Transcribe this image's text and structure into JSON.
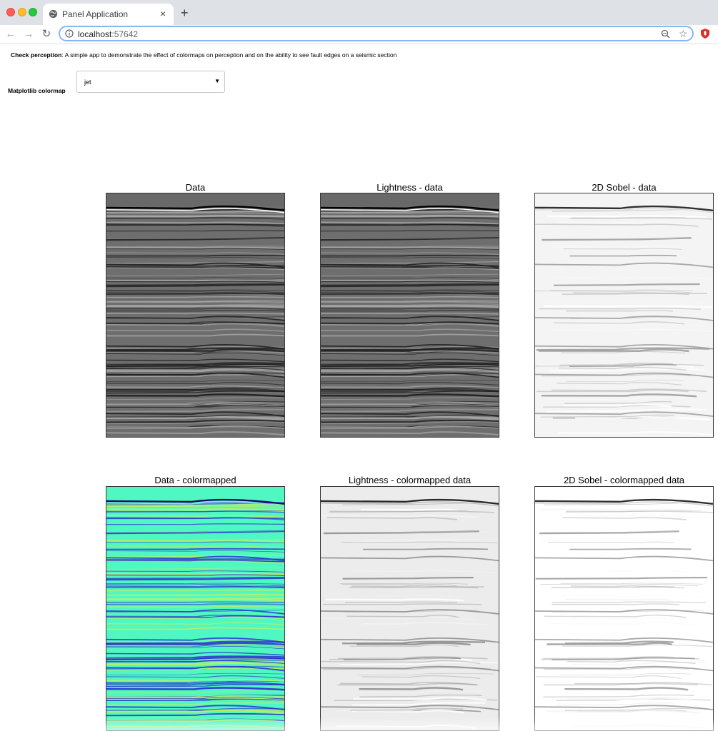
{
  "browser": {
    "tab_title": "Panel Application",
    "new_tab_label": "+",
    "close_tab_label": "×",
    "url_host": "localhost",
    "url_port": ":57642"
  },
  "app": {
    "description_bold": "Check perception",
    "description_rest": ": A simple app to demonstrate the effect of colormaps on perception and on the ability to see fault edges on a seismic section",
    "colormap_label": "Matplotlib colormap",
    "colormap_value": "jet"
  },
  "panels": [
    {
      "title": "Data",
      "style": "gray",
      "bg": "#6e6e6e"
    },
    {
      "title": "Lightness - data",
      "style": "gray",
      "bg": "#6e6e6e"
    },
    {
      "title": "2D Sobel - data",
      "style": "sobel",
      "bg": "#f4f4f4"
    },
    {
      "title": "Data - colormapped",
      "style": "jet",
      "bg": "#4ff7c2"
    },
    {
      "title": "Lightness - colormapped data",
      "style": "light",
      "bg": "#ececec"
    },
    {
      "title": "2D Sobel - colormapped data",
      "style": "sobel2",
      "bg": "#ffffff"
    }
  ],
  "icons": {
    "favicon": "globe-icon",
    "info": "info-icon",
    "zoom": "zoom-icon",
    "star": "star-icon",
    "extension": "extension-icon"
  }
}
